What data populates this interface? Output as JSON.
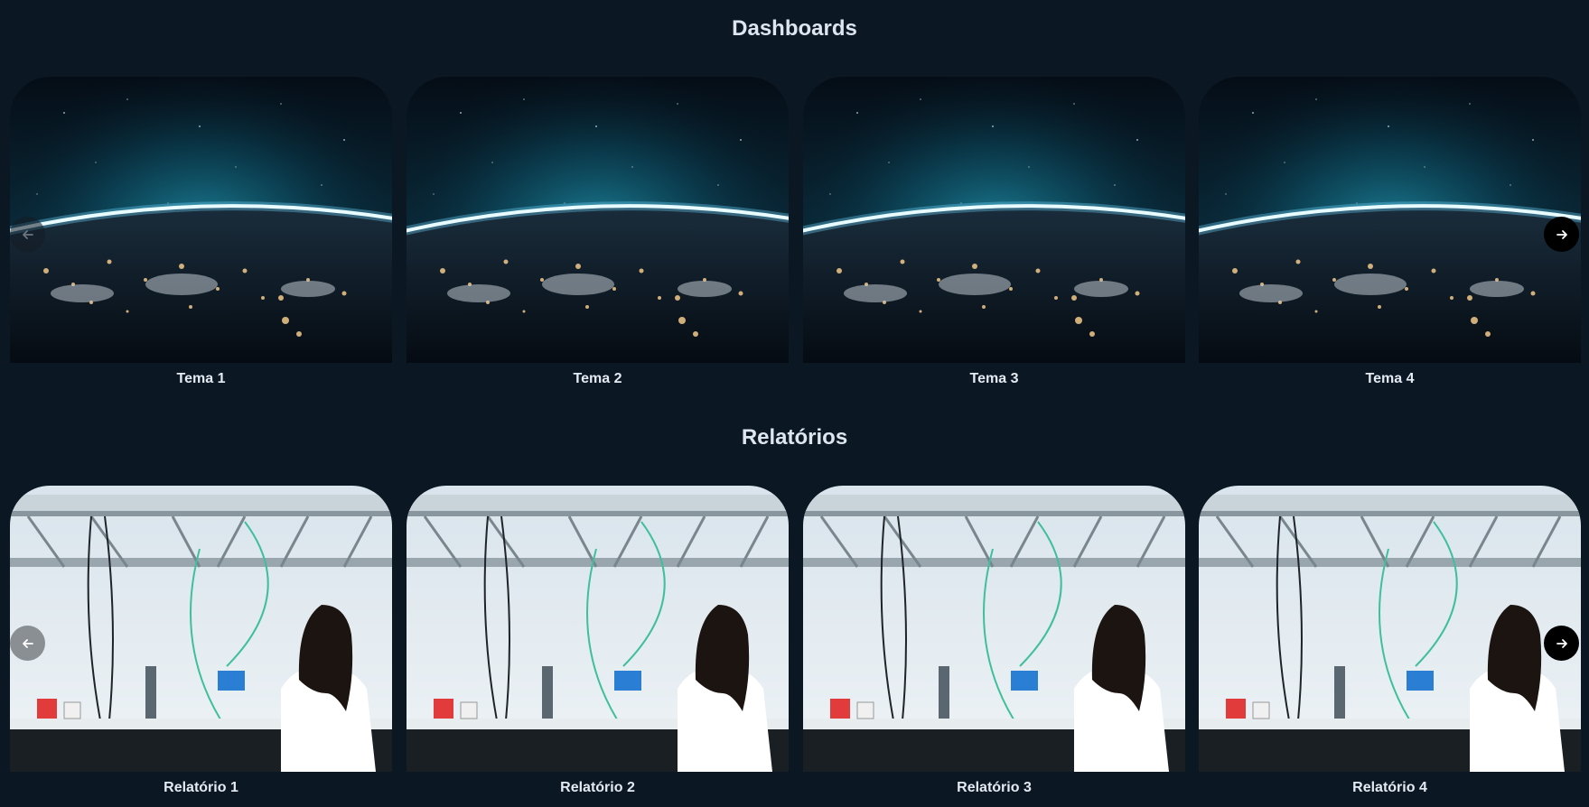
{
  "dashboards": {
    "title": "Dashboards",
    "items": [
      {
        "caption": "Tema 1",
        "image": "earth-night-from-space"
      },
      {
        "caption": "Tema 2",
        "image": "earth-night-from-space"
      },
      {
        "caption": "Tema 3",
        "image": "earth-night-from-space"
      },
      {
        "caption": "Tema 4",
        "image": "earth-night-from-space"
      }
    ],
    "prev_icon": "arrow-left-icon",
    "next_icon": "arrow-right-icon"
  },
  "relatorios": {
    "title": "Relatórios",
    "items": [
      {
        "caption": "Relatório 1",
        "image": "scientist-in-laboratory"
      },
      {
        "caption": "Relatório 2",
        "image": "scientist-in-laboratory"
      },
      {
        "caption": "Relatório 3",
        "image": "scientist-in-laboratory"
      },
      {
        "caption": "Relatório 4",
        "image": "scientist-in-laboratory"
      }
    ],
    "prev_icon": "arrow-left-icon",
    "next_icon": "arrow-right-icon"
  },
  "colors": {
    "background": "#0b1824",
    "text": "#e4eaf2",
    "nav_active": "#000000",
    "nav_disabled": "#8a8f94"
  }
}
